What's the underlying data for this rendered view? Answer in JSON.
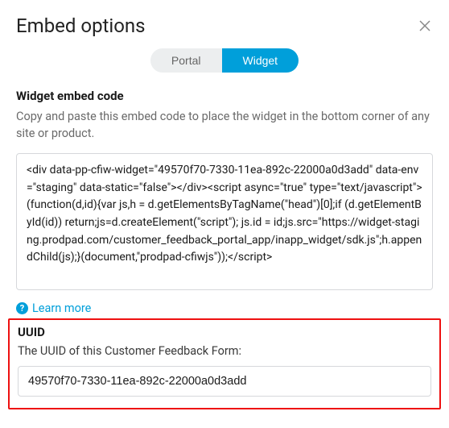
{
  "header": {
    "title": "Embed options"
  },
  "tabs": {
    "portal": "Portal",
    "widget": "Widget"
  },
  "widget_section": {
    "label": "Widget embed code",
    "helper": "Copy and paste this embed code to place the widget in the bottom corner of any site or product.",
    "code": "<div data-pp-cfiw-widget=\"49570f70-7330-11ea-892c-22000a0d3add\" data-env=\"staging\" data-static=\"false\"></div><script async=\"true\" type=\"text/javascript\">(function(d,id){var js,h = d.getElementsByTagName(\"head\")[0];if (d.getElementById(id)) return;js=d.createElement(\"script\"); js.id = id;js.src=\"https://widget-staging.prodpad.com/customer_feedback_portal_app/inapp_widget/sdk.js\";h.appendChild(js);}(document,\"prodpad-cfiwjs\"));</script>"
  },
  "learn_more": "Learn more",
  "uuid_section": {
    "title": "UUID",
    "desc": "The UUID of this Customer Feedback Form:",
    "value": "49570f70-7330-11ea-892c-22000a0d3add"
  }
}
